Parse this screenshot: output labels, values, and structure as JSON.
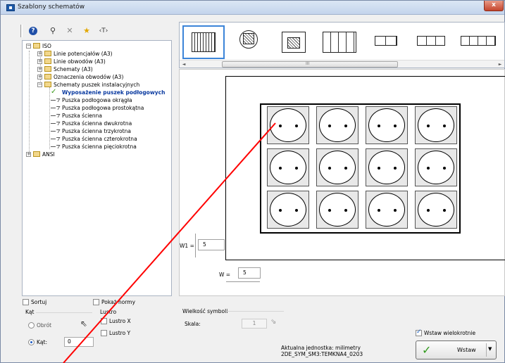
{
  "window": {
    "title": "Szablony schematów",
    "close_label": "x"
  },
  "toolbar": {
    "textsize_label": "‹T›"
  },
  "tree": {
    "iso": "ISO",
    "linie_potencjalow": "Linie potencjałów (A3)",
    "linie_obwodow": "Linie obwodów (A3)",
    "schematy": "Schematy (A3)",
    "oznaczenia_obwodow": "Oznaczenia obwodów (A3)",
    "schematy_puszek": "Schematy puszek instalacyjnych",
    "wyposazenie": "Wyposażenie puszek podłogowych",
    "puszka_okragla": "Puszka podłogowa okrągła",
    "puszka_prostokatna": "Puszka podłogowa prostokątna",
    "puszka_scienna": "Puszka ścienna",
    "puszka_dwukrotna": "Puszka ścienna dwukrotna",
    "puszka_trzykrotna": "Puszka ścienna trzykrotna",
    "puszka_czterokrotna": "Puszka ścienna czterokrotna",
    "puszka_pieciokrotna": "Puszka ścienna pięciokrotna",
    "ansi": "ANSI"
  },
  "thumbnails": {
    "scroll_mark": "III"
  },
  "preview": {
    "grid": {
      "rows": 3,
      "cols": 4
    },
    "w1_label": "W1 =",
    "w1_value": "5",
    "w_label": "W =",
    "w_value": "5"
  },
  "options": {
    "sortuj": "Sortuj",
    "pokaz_normy": "Pokaż normy",
    "kat_group": "Kąt",
    "obrot": "Obrót",
    "kat_label": "Kąt:",
    "kat_value": "0",
    "lustro_group": "Lustro",
    "lustro_x": "Lustro X",
    "lustro_y": "Lustro Y",
    "wielkosc_group": "Wielkość symboli",
    "skala_label": "Skala:",
    "skala_value": "1",
    "wstaw_wielokrotnie": "Wstaw wielokrotnie",
    "aktualna_jednostka": "Aktualna jednostka: milimetry",
    "symbol_id": "2DE_SYM_SM3:TEMKNA4_0203",
    "wstaw_button": "Wstaw"
  },
  "colors": {
    "selection_border": "#3b84d8",
    "annotation_line": "#ff0000",
    "selected_text": "#0a3aa0"
  }
}
